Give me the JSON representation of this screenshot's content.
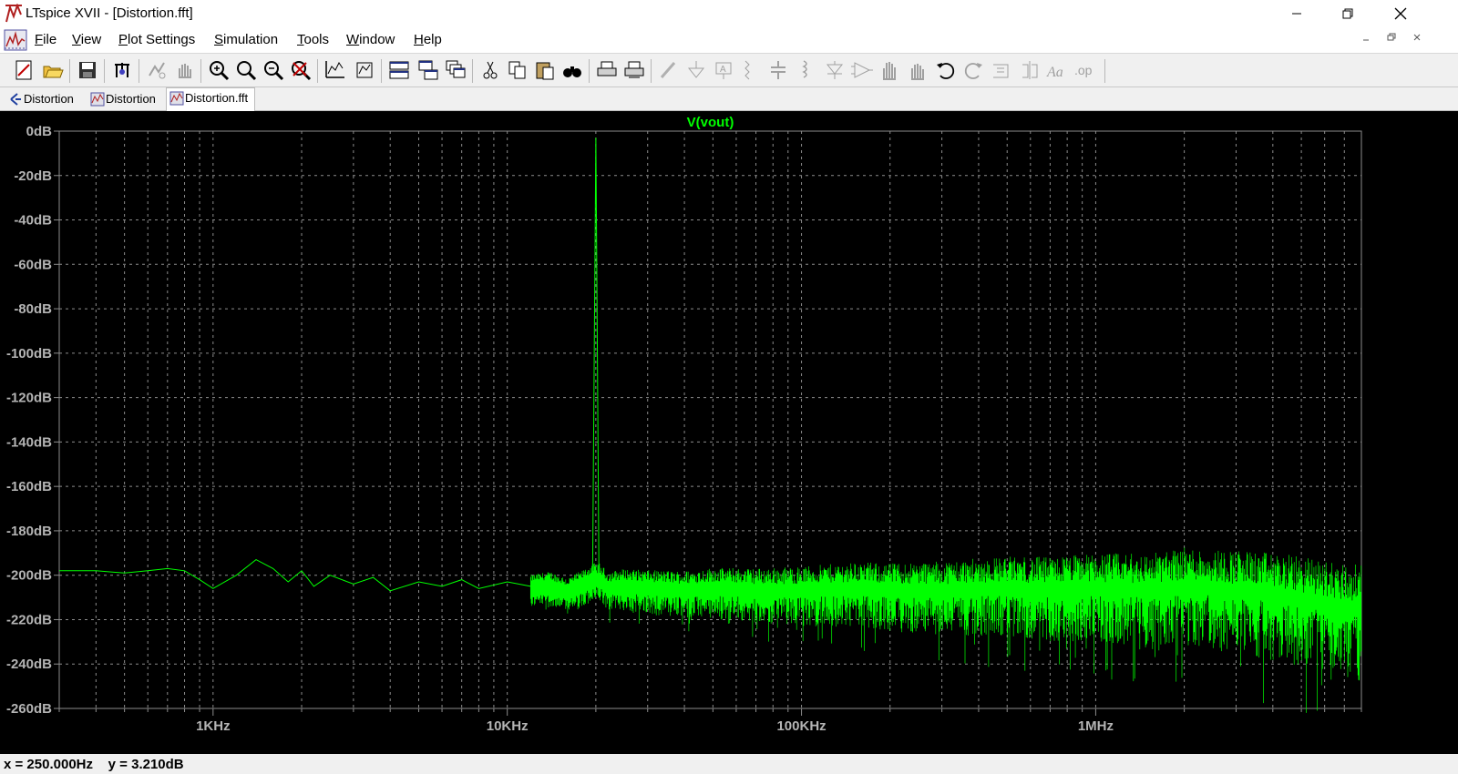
{
  "window": {
    "title": "LTspice XVII - [Distortion.fft]"
  },
  "menu": [
    "File",
    "View",
    "Plot Settings",
    "Simulation",
    "Tools",
    "Window",
    "Help"
  ],
  "tabs": [
    {
      "label": "Distortion",
      "icon": "schematic-icon"
    },
    {
      "label": "Distortion",
      "icon": "waveform-icon"
    },
    {
      "label": "Distortion.fft",
      "icon": "waveform-icon",
      "active": true
    }
  ],
  "toolbar_icons": [
    "new-schematic-icon",
    "open-icon",
    "save-icon",
    "control-panel-icon",
    "run-icon",
    "halt-icon",
    "zoom-in-icon",
    "zoom-to-fit-icon",
    "zoom-out-icon",
    "zoom-cancel-icon",
    "autorange-icon",
    "rescale-icon",
    "tile-horizontal-icon",
    "tile-vertical-icon",
    "cascade-icon",
    "cut-icon",
    "copy-icon",
    "paste-icon",
    "find-icon",
    "print-icon",
    "print-preview-icon",
    "wire-icon",
    "ground-icon",
    "label-net-icon",
    "resistor-icon",
    "capacitor-icon",
    "inductor-icon",
    "diode-icon",
    "component-icon",
    "move-icon",
    "drag-icon",
    "undo-icon",
    "redo-icon",
    "rotate-icon",
    "mirror-icon",
    "text-icon",
    "spice-directive-icon"
  ],
  "plot": {
    "trace_name": "V(vout)",
    "trace_color": "#00ff00",
    "background": "#000000",
    "grid_color": "#8c8c8c",
    "y_ticks": [
      "0dB",
      "-20dB",
      "-40dB",
      "-60dB",
      "-80dB",
      "-100dB",
      "-120dB",
      "-140dB",
      "-160dB",
      "-180dB",
      "-200dB",
      "-220dB",
      "-240dB",
      "-260dB"
    ],
    "x_ticks": [
      "1KHz",
      "10KHz",
      "100KHz",
      "1MHz"
    ]
  },
  "chart_data": {
    "type": "line",
    "title": "V(vout)",
    "x_scale": "log",
    "xlim_hz": [
      300,
      8000000
    ],
    "ylim_db": [
      -260,
      0
    ],
    "grid": true,
    "x_tick_values_hz": [
      1000,
      10000,
      100000,
      1000000
    ],
    "y_tick_values_db": [
      0,
      -20,
      -40,
      -60,
      -80,
      -100,
      -120,
      -140,
      -160,
      -180,
      -200,
      -220,
      -240,
      -260
    ],
    "series": [
      {
        "name": "V(vout)",
        "x": [
          300,
          400,
          500,
          600,
          700,
          800,
          900,
          1000,
          1200,
          1400,
          1600,
          1800,
          2000,
          2200,
          2500,
          3000,
          3500,
          4000,
          5000,
          6000,
          7000,
          8000,
          10000,
          12000,
          14000,
          16000,
          18000,
          19500,
          20000,
          20500,
          22000,
          25000,
          30000,
          40000,
          50000,
          70000,
          100000,
          150000,
          200000,
          300000,
          500000,
          700000,
          1000000,
          1500000,
          2000000,
          3000000,
          4000000,
          5000000,
          6000000,
          7000000,
          8000000
        ],
        "y": [
          -198,
          -198,
          -199,
          -198,
          -197,
          -198,
          -202,
          -206,
          -200,
          -193,
          -197,
          -203,
          -198,
          -205,
          -200,
          -204,
          -201,
          -207,
          -203,
          -205,
          -202,
          -206,
          -203,
          -205,
          -204,
          -207,
          -204,
          -201,
          -3,
          -201,
          -205,
          -204,
          -205,
          -206,
          -205,
          -206,
          -206,
          -205,
          -206,
          -206,
          -205,
          -206,
          -205,
          -206,
          -204,
          -206,
          -208,
          -210,
          -212,
          -214,
          -215
        ]
      }
    ]
  },
  "status": {
    "x_label": "x = 250.000Hz",
    "y_label": "y = 3.210dB"
  }
}
